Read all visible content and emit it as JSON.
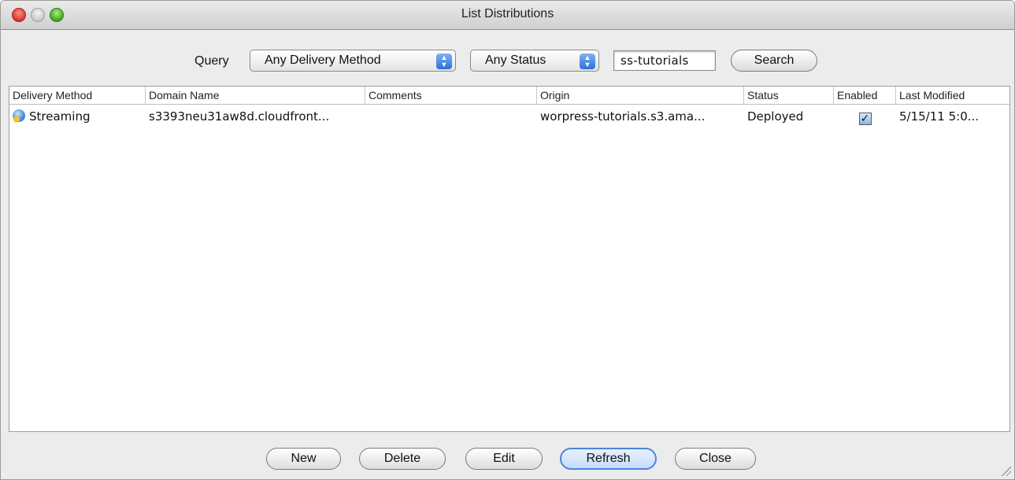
{
  "window": {
    "title": "List Distributions"
  },
  "query": {
    "label": "Query",
    "delivery_method_selected": "Any Delivery Method",
    "status_selected": "Any Status",
    "search_value": "ss-tutorials",
    "search_button": "Search"
  },
  "table": {
    "columns": [
      "Delivery Method",
      "Domain Name",
      "Comments",
      "Origin",
      "Status",
      "Enabled",
      "Last Modified"
    ],
    "rows": [
      {
        "delivery_method": "Streaming",
        "domain_name": "s3393neu31aw8d.cloudfront...",
        "comments": "",
        "origin": "worpress-tutorials.s3.ama...",
        "status": "Deployed",
        "enabled": true,
        "enabled_mark": "✓",
        "last_modified": "5/15/11 5:0..."
      }
    ]
  },
  "buttons": {
    "new": "New",
    "delete": "Delete",
    "edit": "Edit",
    "refresh": "Refresh",
    "close": "Close"
  },
  "colors": {
    "accent": "#4c86d9",
    "close_light": "#d8362b",
    "max_light": "#3fa51e"
  }
}
